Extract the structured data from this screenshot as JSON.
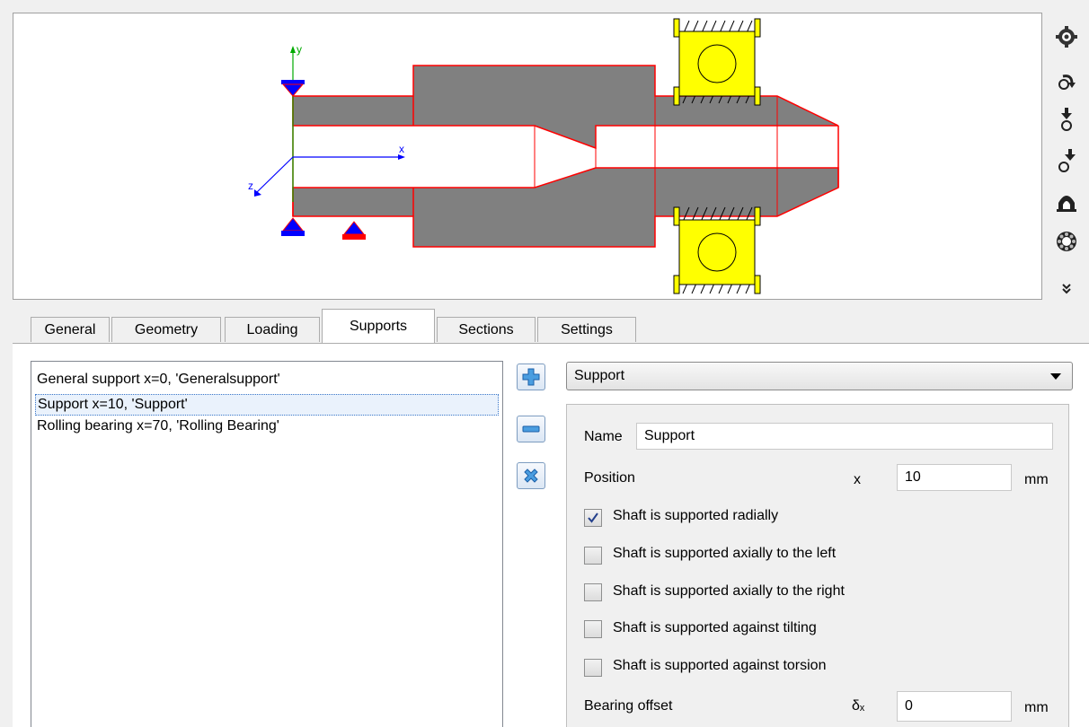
{
  "toolbar": {
    "icons": [
      "gear-icon",
      "load-arrow-icon",
      "force-down-icon",
      "force-diagonal-icon",
      "support-icon",
      "bearing-ring-icon",
      "expand-more-icon"
    ]
  },
  "drawing": {
    "axis_x": "x",
    "axis_y": "y",
    "axis_z": "z",
    "colors": {
      "shaft": "#808080",
      "shaft_outline": "#ff0000",
      "bearing": "#ffff00",
      "support": "#0000ff",
      "axis_x": "#0000ff",
      "axis_y": "#00aa00"
    }
  },
  "tabs": [
    {
      "label": "General",
      "active": false
    },
    {
      "label": "Geometry",
      "active": false
    },
    {
      "label": "Loading",
      "active": false
    },
    {
      "label": "Supports",
      "active": true
    },
    {
      "label": "Sections",
      "active": false
    },
    {
      "label": "Settings",
      "active": false
    }
  ],
  "supports_list": [
    {
      "label": "General support  x=0, 'Generalsupport'",
      "selected": false
    },
    {
      "label": "Support  x=10, 'Support'",
      "selected": true
    },
    {
      "label": "Rolling bearing  x=70, 'Rolling Bearing'",
      "selected": false
    }
  ],
  "list_buttons": {
    "add": "add-icon",
    "remove": "remove-icon",
    "delete": "delete-icon"
  },
  "support_type": {
    "selected": "Support"
  },
  "form": {
    "name_label": "Name",
    "name_value": "Support",
    "position_label": "Position",
    "position_symbol": "x",
    "position_value": "10",
    "position_unit": "mm",
    "checkboxes": [
      {
        "label": "Shaft is supported radially",
        "checked": true
      },
      {
        "label": "Shaft is supported axially to the left",
        "checked": false
      },
      {
        "label": "Shaft is supported axially to the right",
        "checked": false
      },
      {
        "label": "Shaft is supported against tilting",
        "checked": false
      },
      {
        "label": "Shaft is supported against torsion",
        "checked": false
      }
    ],
    "offset_label": "Bearing offset",
    "offset_symbol": "δₓ",
    "offset_value": "0",
    "offset_unit": "mm"
  }
}
